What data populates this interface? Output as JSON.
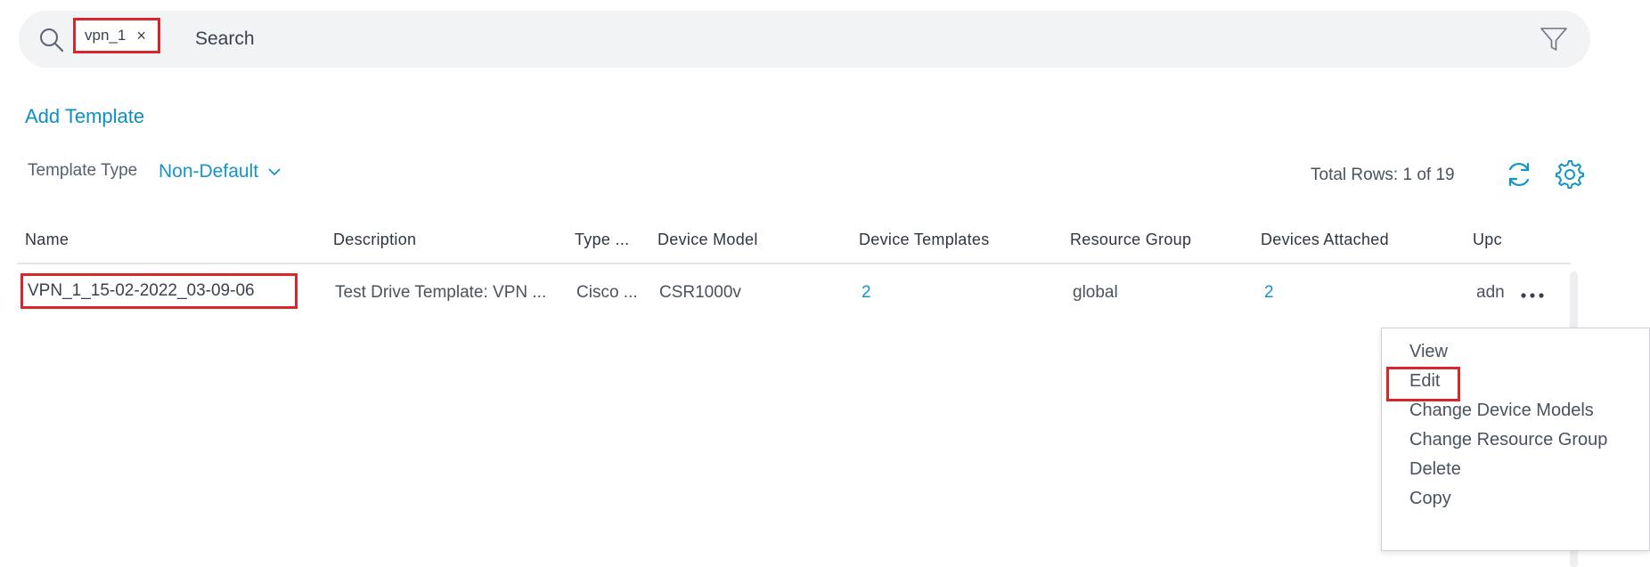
{
  "search": {
    "chip_label": "vpn_1",
    "chip_close": "×",
    "placeholder": "Search"
  },
  "actions": {
    "add_template": "Add Template"
  },
  "filter": {
    "label": "Template Type",
    "value": "Non-Default"
  },
  "table_meta": {
    "total_rows": "Total Rows: 1 of 19"
  },
  "table": {
    "columns": [
      "Name",
      "Description",
      "Type ...",
      "Device Model",
      "Device Templates",
      "Resource Group",
      "Devices Attached",
      "Upc"
    ],
    "rows": [
      {
        "name": "VPN_1_15-02-2022_03-09-06",
        "description": "Test Drive Template: VPN ...",
        "type": "Cisco ...",
        "device_model": "CSR1000v",
        "device_templates": "2",
        "resource_group": "global",
        "devices_attached": "2",
        "updated_by": "adn"
      }
    ]
  },
  "context_menu": {
    "items": [
      "View",
      "Edit",
      "Change Device Models",
      "Change Resource Group",
      "Delete",
      "Copy"
    ]
  },
  "colors": {
    "accent": "#1494c9",
    "highlight": "#d9262a"
  }
}
